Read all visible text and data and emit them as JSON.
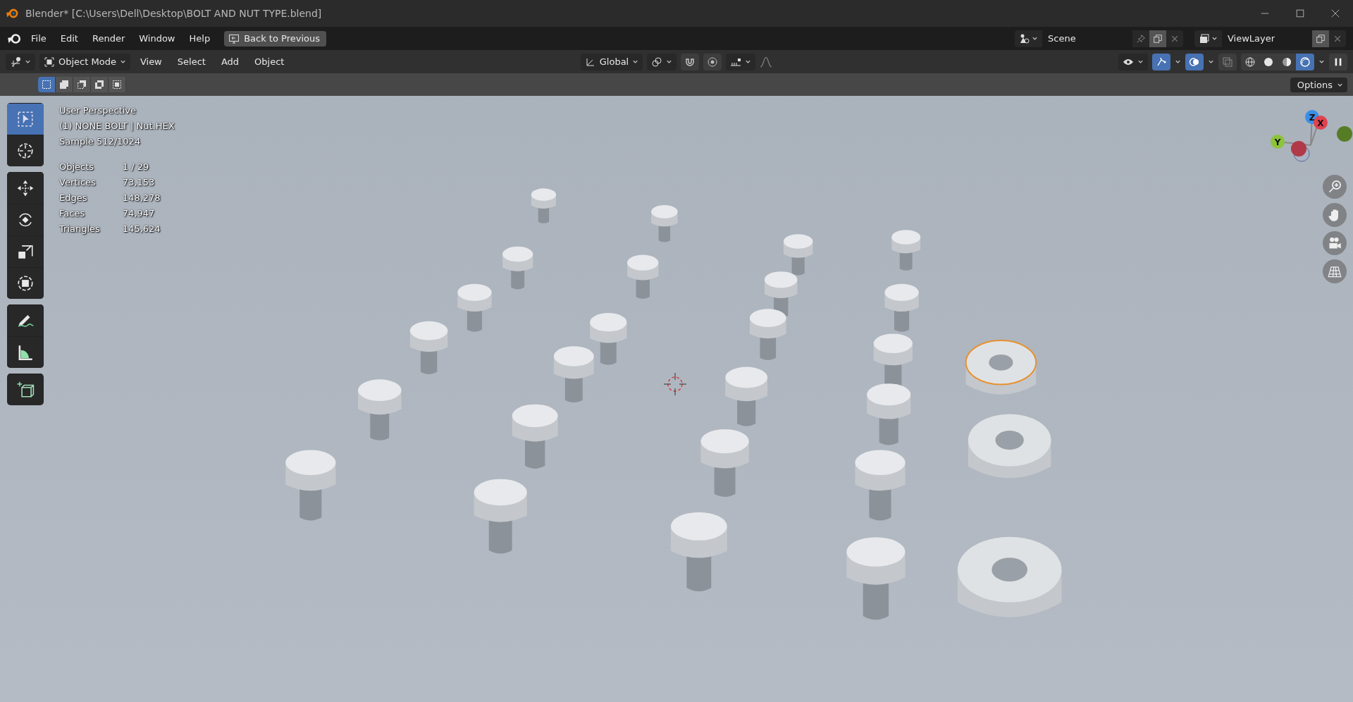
{
  "window": {
    "title": "Blender* [C:\\Users\\Dell\\Desktop\\BOLT AND NUT TYPE.blend]"
  },
  "menu": {
    "items": [
      "File",
      "Edit",
      "Render",
      "Window",
      "Help"
    ],
    "back_button": "Back to Previous"
  },
  "scene": {
    "name": "Scene"
  },
  "view_layer": {
    "name": "ViewLayer"
  },
  "header": {
    "mode": "Object Mode",
    "menus": [
      "View",
      "Select",
      "Add",
      "Object"
    ],
    "orientation": "Global"
  },
  "toggles": [
    {
      "kind": "snap",
      "on": false
    },
    {
      "kind": "proportional",
      "on": false
    },
    {
      "kind": "gizmo",
      "on": true
    },
    {
      "kind": "overlay",
      "on": true
    },
    {
      "kind": "xray",
      "on": false
    }
  ],
  "shading": [
    {
      "kind": "wireframe",
      "selected": false
    },
    {
      "kind": "solid",
      "selected": false
    },
    {
      "kind": "material",
      "selected": false
    },
    {
      "kind": "rendered",
      "selected": true
    }
  ],
  "select_modes": [
    {
      "kind": "new",
      "selected": true
    },
    {
      "kind": "extend",
      "selected": false
    },
    {
      "kind": "subtract",
      "selected": false
    },
    {
      "kind": "invert",
      "selected": false
    },
    {
      "kind": "intersect",
      "selected": false
    }
  ],
  "options_button": "Options",
  "tools": [
    {
      "kind": "select_box",
      "selected": true
    },
    {
      "kind": "cursor",
      "selected": false
    },
    {
      "kind": "move",
      "selected": false
    },
    {
      "kind": "rotate",
      "selected": false
    },
    {
      "kind": "scale",
      "selected": false
    },
    {
      "kind": "transform",
      "selected": false
    },
    {
      "kind": "annotate",
      "selected": false
    },
    {
      "kind": "measure",
      "selected": false
    },
    {
      "kind": "add_cube",
      "selected": false
    }
  ],
  "viewport": {
    "view_name": "User Perspective",
    "object_name": "(1) NONE BOLT | Nut.HEX",
    "sample": "Sample 512/1024",
    "stats": [
      {
        "label": "Objects",
        "value": "1 / 29"
      },
      {
        "label": "Vertices",
        "value": "73,153"
      },
      {
        "label": "Edges",
        "value": "148,278"
      },
      {
        "label": "Faces",
        "value": "74,947"
      },
      {
        "label": "Triangles",
        "value": "145,624"
      }
    ],
    "axes": [
      {
        "label": "Y",
        "color": "#8cc43a"
      },
      {
        "label": "Z",
        "color": "#3a8ee6"
      },
      {
        "label": "X",
        "color": "#e0424f"
      }
    ]
  }
}
